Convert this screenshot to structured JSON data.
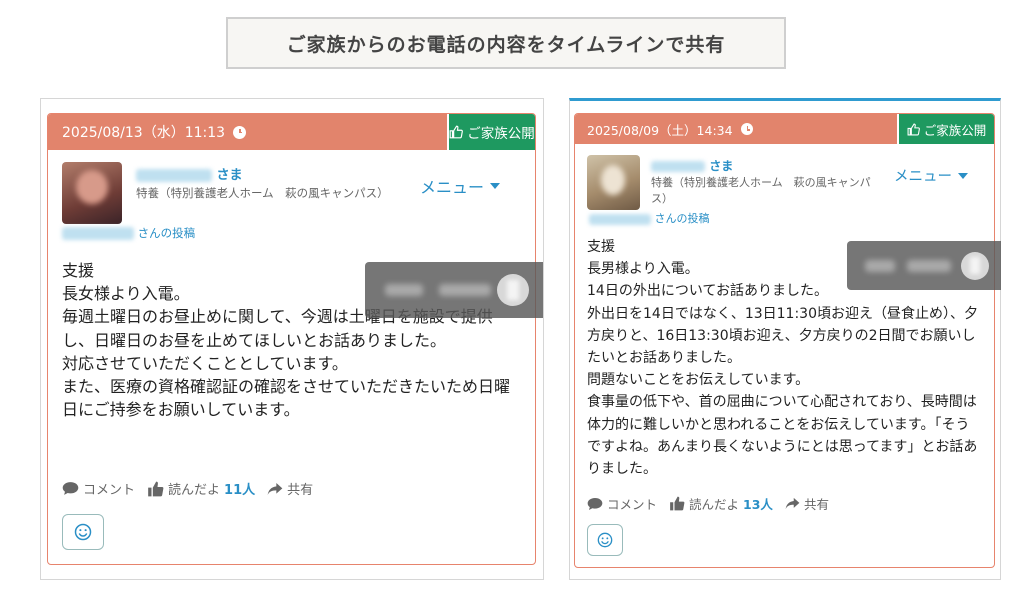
{
  "header": {
    "title": "ご家族からのお電話の内容をタイムラインで共有"
  },
  "colors": {
    "date_bar": "#e2846c",
    "public_button": "#1e9960",
    "accent": "#2a8fc6",
    "border": "#e7846d",
    "frame_top_right": "#2f9bd0"
  },
  "posts": [
    {
      "date": "2025/08/13（水）11:13",
      "public_label": "ご家族公開",
      "resident_suffix": "さま",
      "facility": "特養（特別養護老人ホーム　萩の風キャンパス）",
      "poster_suffix": "さんの投稿",
      "menu_label": "メニュー",
      "body": "支援\n長女様より入電。\n毎週土曜日のお昼止めに関して、今週は土曜日を施設で提供し、日曜日のお昼を止めてほしいとお話ありました。\n対応させていただくこととしています。\nまた、医療の資格確認証の確認をさせていただきたいため日曜日にご持参をお願いしています。",
      "comment_label": "コメント",
      "like_label": "読んだよ",
      "like_count": "11人",
      "share_label": "共有"
    },
    {
      "date": "2025/08/09（土）14:34",
      "public_label": "ご家族公開",
      "resident_suffix": "さま",
      "facility": "特養（特別養護老人ホーム　萩の風キャンパス）",
      "poster_suffix": "さんの投稿",
      "menu_label": "メニュー",
      "body": "支援\n長男様より入電。\n14日の外出についてお話ありました。\n外出日を14日ではなく、13日11:30頃お迎え（昼食止め）、夕方戻りと、16日13:30頃お迎え、夕方戻りの2日間でお願いしたいとお話ありました。\n問題ないことをお伝えしています。\n食事量の低下や、首の屈曲について心配されており、長時間は体力的に難しいかと思われることをお伝えしています。「そうですよね。あんまり長くないようにとは思ってます」とお話ありました。",
      "comment_label": "コメント",
      "like_label": "読んだよ",
      "like_count": "13人",
      "share_label": "共有"
    }
  ]
}
